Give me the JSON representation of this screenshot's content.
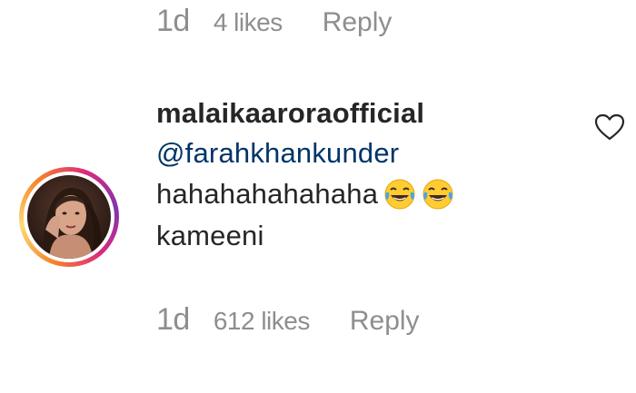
{
  "previous_comment": {
    "time": "1d",
    "likes": "4 likes",
    "reply_label": "Reply"
  },
  "comment": {
    "username": "malaikaaroraofficial",
    "mention": "@farahkhankunder",
    "text_line": "hahahahahahaha",
    "emojis": [
      "laughing-tears-emoji",
      "laughing-tears-emoji"
    ],
    "text_line2": "kameeni",
    "time": "1d",
    "likes": "612 likes",
    "reply_label": "Reply"
  },
  "icons": {
    "like": "heart-icon"
  },
  "colors": {
    "meta_gray": "#8e8e8e",
    "text": "#262626",
    "mention": "#003569"
  }
}
